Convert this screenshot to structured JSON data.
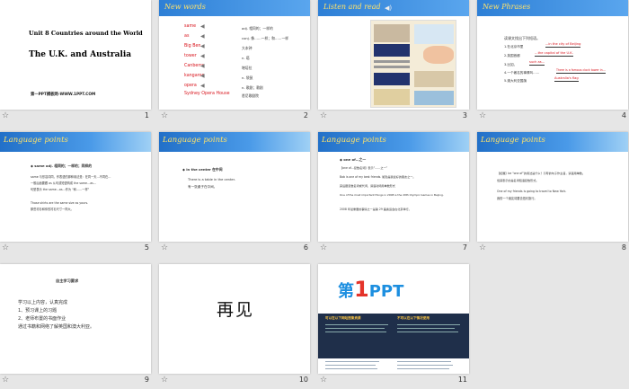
{
  "slides": [
    {
      "num": "1",
      "title": "Unit 8 Countries  around  the World",
      "subtitle": "The U.K.  and  Australia",
      "footer": "第一PPT模板网-WWW.1PPT.COM"
    },
    {
      "num": "2",
      "header": "New  words",
      "words": [
        "same",
        "as",
        "Big Ben",
        "tower",
        "Canberra",
        "kangaroo",
        "opera",
        "Sydney Opera House"
      ],
      "defs": [
        "adj. 相同的；一样的",
        "conj. 像……一样；和……一样",
        "大本钟",
        "n. 塔",
        "堪培拉",
        "n. 袋鼠",
        "n. 歌剧；歌剧",
        "悉尼歌剧院"
      ]
    },
    {
      "num": "3",
      "header": "Listen and read"
    },
    {
      "num": "4",
      "header": "New  Phrases",
      "intro": "读课文找出下列短语。",
      "items": [
        "1.在北京市里",
        "2.英国首都",
        "3.比如，",
        "4.一个著名的事情叫……",
        "5.澳大利亚国旗"
      ],
      "answers": [
        "...in the city of Beijing",
        "…the capital of the U.K.",
        "such as…",
        "There is a famous clock tower in…",
        "Australia's flag"
      ]
    },
    {
      "num": "5",
      "header": "Language points",
      "point": "same adj. 相同的；一样的；同样的",
      "lines": [
        "same 与形容词同，作表语的那种用法是：在同一天…不同在…",
        "一般后面要跟 as 从句或短语构成 the same…as…",
        "句型表示 the same…as…作为 “和……一样”",
        "Those shirts are the same size as yours.",
        "那些衬衫和你的衬衫尺寸一样大。"
      ]
    },
    {
      "num": "6",
      "header": "Language points",
      "point": "in the center 在中间",
      "lines": [
        "There is a table in the center.",
        "有一张桌子在中间。"
      ]
    },
    {
      "num": "7",
      "header": "Language points",
      "point": "one of…之一",
      "lines": [
        "【one of…复数名词】表示“……之一”",
        "Bob is one of my best friends. 鲍勃是我最好的朋友之一。",
        "其后跟复数名词或代词，谓语动词用单数形式",
        "One of the most important things in 2008 is the 29th Olympic Games in Beijing.",
        "2008 年最重要的事情之一是第 29 届奥运会在北京举行。"
      ]
    },
    {
      "num": "8",
      "header": "Language points",
      "lines": [
        "【拓展】be “one of”的用法是什么？引导的句子作主语，谓语用单数。",
        "但其表示的是名词短语复数形式。",
        "One of my friends is going to travel to New York.",
        "我的一个朋友将要去纽约旅行。"
      ]
    },
    {
      "num": "9",
      "title": "自主学习要求",
      "lines": [
        "学习以上内容，认真完成",
        "1、预习课上的习题",
        "2、老师布置的书面作业",
        "通过书籍和网络了解英国和澳大利亚。"
      ]
    },
    {
      "num": "10",
      "text": "再见"
    },
    {
      "num": "11",
      "logo_a": "第",
      "logo_b": "1",
      "logo_c": "PPT",
      "band_left": "可以在以下网站搜集资源",
      "band_right": "不可以在以下情况使用"
    }
  ],
  "colors": {
    "accent": "#2d7fd6",
    "title_yellow": "#ffe26a",
    "red": "#d8141c"
  }
}
